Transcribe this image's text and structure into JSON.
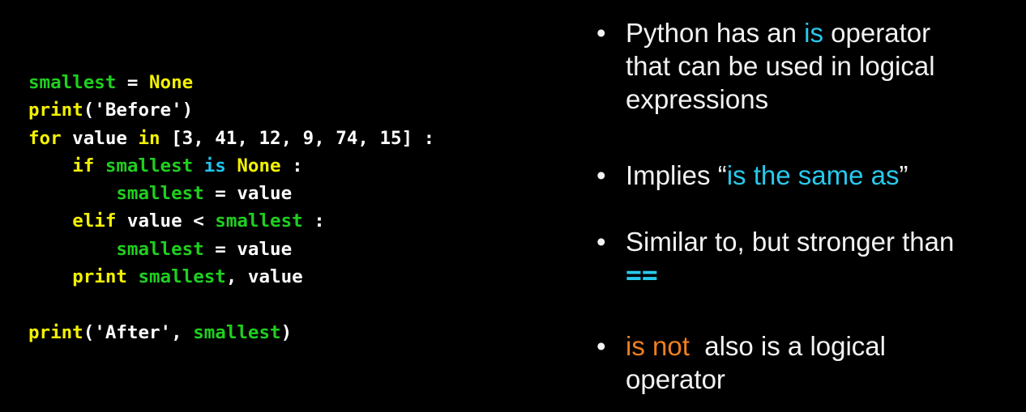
{
  "code": {
    "lines": [
      [
        {
          "t": "smallest",
          "c": "green"
        },
        {
          "t": " = ",
          "c": "white"
        },
        {
          "t": "None",
          "c": "yellow"
        }
      ],
      [
        {
          "t": "print",
          "c": "yellow"
        },
        {
          "t": "('Before')",
          "c": "white"
        }
      ],
      [
        {
          "t": "for",
          "c": "yellow"
        },
        {
          "t": " value ",
          "c": "white"
        },
        {
          "t": "in",
          "c": "yellow"
        },
        {
          "t": " [3, 41, 12, 9, 74, 15] :",
          "c": "white"
        }
      ],
      [
        {
          "t": "    ",
          "c": "white"
        },
        {
          "t": "if",
          "c": "yellow"
        },
        {
          "t": " ",
          "c": "white"
        },
        {
          "t": "smallest",
          "c": "green"
        },
        {
          "t": " ",
          "c": "white"
        },
        {
          "t": "is",
          "c": "cyan"
        },
        {
          "t": " ",
          "c": "white"
        },
        {
          "t": "None",
          "c": "yellow"
        },
        {
          "t": " :",
          "c": "white"
        }
      ],
      [
        {
          "t": "        ",
          "c": "white"
        },
        {
          "t": "smallest",
          "c": "green"
        },
        {
          "t": " = value",
          "c": "white"
        }
      ],
      [
        {
          "t": "    ",
          "c": "white"
        },
        {
          "t": "elif",
          "c": "yellow"
        },
        {
          "t": " value < ",
          "c": "white"
        },
        {
          "t": "smallest",
          "c": "green"
        },
        {
          "t": " :",
          "c": "white"
        }
      ],
      [
        {
          "t": "        ",
          "c": "white"
        },
        {
          "t": "smallest",
          "c": "green"
        },
        {
          "t": " = value",
          "c": "white"
        }
      ],
      [
        {
          "t": "    ",
          "c": "white"
        },
        {
          "t": "print",
          "c": "yellow"
        },
        {
          "t": " ",
          "c": "white"
        },
        {
          "t": "smallest",
          "c": "green"
        },
        {
          "t": ", value",
          "c": "white"
        }
      ],
      [],
      [
        {
          "t": "print",
          "c": "yellow"
        },
        {
          "t": "('After', ",
          "c": "white"
        },
        {
          "t": "smallest",
          "c": "green"
        },
        {
          "t": ")",
          "c": "white"
        }
      ]
    ]
  },
  "bullets": {
    "dot": "•",
    "b1": {
      "line1_pre": "Python has an ",
      "line1_hl": "is",
      "line1_post": " operator",
      "line2": "that can be used in logical",
      "line3": "expressions"
    },
    "b2": {
      "pre": "Implies “",
      "hl": "is the same as",
      "post": "”"
    },
    "b3": {
      "line1": "Similar to, but stronger than",
      "line2": "=="
    },
    "b4": {
      "hl": "is not",
      "line1_post": "  also is a logical",
      "line2": "operator"
    }
  },
  "colors": {
    "background": "#000000",
    "code_default": "#ffffff",
    "code_keyword": "#f2f200",
    "code_variable": "#1fcf1f",
    "code_is": "#20c4ee",
    "bullet_text": "#f2f2f2",
    "highlight_cyan": "#27c9ec",
    "highlight_orange": "#f07f1e"
  }
}
